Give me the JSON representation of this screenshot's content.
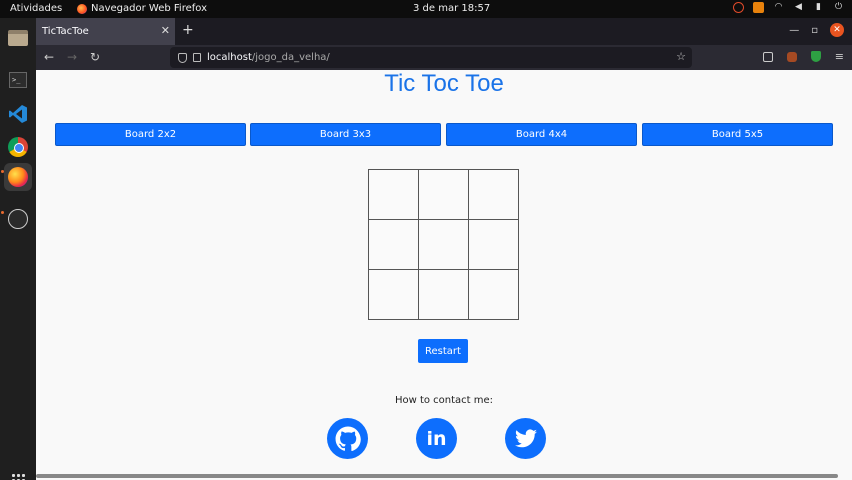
{
  "system": {
    "activities": "Atividades",
    "app_name": "Navegador Web Firefox",
    "clock": "3 de mar  18:57"
  },
  "browser": {
    "tab_title": "TicTacToe",
    "url_host": "localhost",
    "url_path": "/jogo_da_velha/"
  },
  "page": {
    "title": "Tic Toc Toe",
    "board_buttons": [
      "Board 2x2",
      "Board 3x3",
      "Board 4x4",
      "Board 5x5"
    ],
    "board_size": 3,
    "restart_label": "Restart",
    "contact_label": "How to contact me:",
    "social": [
      "github-icon",
      "linkedin-icon",
      "twitter-icon"
    ],
    "accent_color": "#0d6efd",
    "title_color": "#1a73e8"
  }
}
